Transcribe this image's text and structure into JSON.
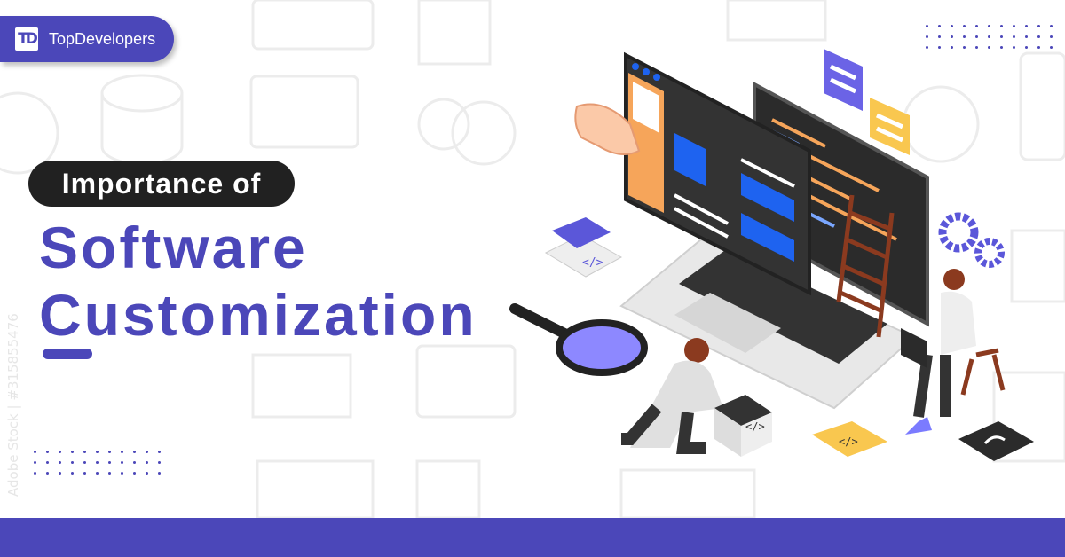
{
  "brand": {
    "name": "TopDevelopers",
    "logo_text": "TD",
    "color": "#4b47b9"
  },
  "headline": {
    "eyebrow": "Importance of",
    "line1": "Software",
    "line2": "Customization"
  },
  "illustration": {
    "code_tag_1": "</>",
    "code_tag_2": "</>",
    "code_tag_3": "</>"
  },
  "watermark": "Adobe Stock | #315855476",
  "colors": {
    "accent": "#4b47b9",
    "dark": "#212121",
    "orange": "#f6a55a",
    "yellow": "#f9c74f",
    "blue": "#1e63f0"
  }
}
